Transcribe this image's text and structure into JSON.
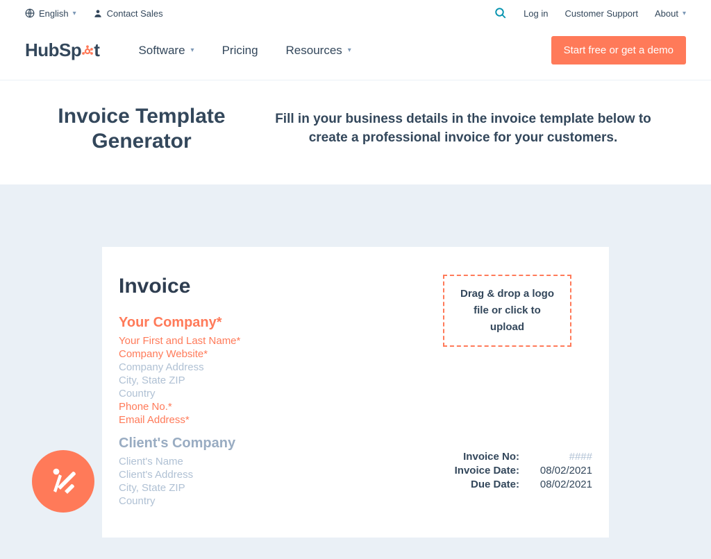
{
  "topbar": {
    "language": "English",
    "contact": "Contact Sales",
    "login": "Log in",
    "support": "Customer Support",
    "about": "About"
  },
  "nav": {
    "logo_a": "HubSp",
    "logo_b": "t",
    "software": "Software",
    "pricing": "Pricing",
    "resources": "Resources",
    "cta": "Start free or get a demo"
  },
  "hero": {
    "title": "Invoice Template Generator",
    "subtitle": "Fill in your business details in the invoice template below to create a professional invoice for your customers."
  },
  "invoice": {
    "title": "Invoice",
    "dropzone": "Drag & drop a logo file or click to upload",
    "your": {
      "company": "Your Company*",
      "name": "Your First and Last Name*",
      "website": "Company Website*",
      "address": "Company Address",
      "csz": "City, State ZIP",
      "country": "Country",
      "phone": "Phone No.*",
      "email": "Email Address*"
    },
    "client": {
      "company": "Client's Company",
      "name": "Client's Name",
      "address": "Client's Address",
      "csz": "City, State ZIP",
      "country": "Country"
    },
    "meta": {
      "no_label": "Invoice No:",
      "no_val": "####",
      "date_label": "Invoice Date:",
      "date_val": "08/02/2021",
      "due_label": "Due Date:",
      "due_val": "08/02/2021"
    }
  }
}
